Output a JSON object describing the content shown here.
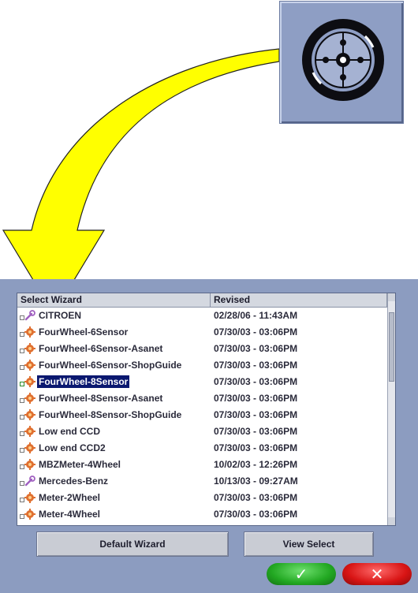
{
  "list": {
    "columns": [
      "Select Wizard",
      "Revised"
    ],
    "rows": [
      {
        "name": "CITROEN",
        "revised": "02/28/06 - 11:43AM",
        "icon": "wrench-icon"
      },
      {
        "name": "FourWheel-6Sensor",
        "revised": "07/30/03 - 03:06PM",
        "icon": "gear-icon"
      },
      {
        "name": "FourWheel-6Sensor-Asanet",
        "revised": "07/30/03 - 03:06PM",
        "icon": "gear-icon"
      },
      {
        "name": "FourWheel-6Sensor-ShopGuide",
        "revised": "07/30/03 - 03:06PM",
        "icon": "gear-icon"
      },
      {
        "name": "FourWheel-8Sensor",
        "revised": "07/30/03 - 03:06PM",
        "icon": "gear-icon",
        "selected": true
      },
      {
        "name": "FourWheel-8Sensor-Asanet",
        "revised": "07/30/03 - 03:06PM",
        "icon": "gear-icon"
      },
      {
        "name": "FourWheel-8Sensor-ShopGuide",
        "revised": "07/30/03 - 03:06PM",
        "icon": "gear-icon"
      },
      {
        "name": "Low end CCD",
        "revised": "07/30/03 - 03:06PM",
        "icon": "gear-icon"
      },
      {
        "name": "Low end CCD2",
        "revised": "07/30/03 - 03:06PM",
        "icon": "gear-icon"
      },
      {
        "name": "MBZMeter-4Wheel",
        "revised": "10/02/03 - 12:26PM",
        "icon": "gear-icon"
      },
      {
        "name": "Mercedes-Benz",
        "revised": "10/13/03 - 09:27AM",
        "icon": "wrench-icon"
      },
      {
        "name": "Meter-2Wheel",
        "revised": "07/30/03 - 03:06PM",
        "icon": "gear-icon"
      },
      {
        "name": "Meter-4Wheel",
        "revised": "07/30/03 - 03:06PM",
        "icon": "gear-icon"
      }
    ]
  },
  "buttons": {
    "default_wizard": "Default Wizard",
    "view_select": "View Select",
    "ok_glyph": "✓",
    "cancel_glyph": "✕"
  },
  "colors": {
    "panel": "#8c9cc0",
    "selection": "#0a1870",
    "arrow": "#ffff00",
    "ok": "#22a822",
    "cancel": "#d81414"
  }
}
